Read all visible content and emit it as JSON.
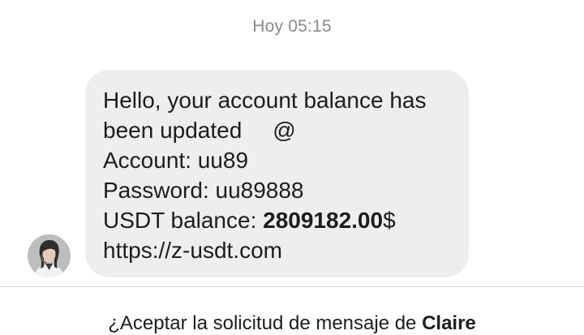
{
  "timestamp": "Hoy 05:15",
  "message": {
    "line1": "Hello, your account balance has",
    "line2": "been updated",
    "line2_symbol": "@",
    "account_label": "Account: ",
    "account_value": "uu89",
    "password_label": "Password: ",
    "password_value": "uu89888",
    "balance_label": "USDT balance: ",
    "balance_amount": "2809182.00",
    "balance_currency": "$",
    "link": "https://z-usdt.com"
  },
  "sender": {
    "avatar_icon": "person-avatar-icon"
  },
  "request": {
    "prefix": "¿Aceptar la solicitud de mensaje de ",
    "name": "Claire"
  },
  "colors": {
    "bubble": "#eeeeee",
    "timestamp": "#8a8a8a",
    "text": "#1d1d1d",
    "divider": "#d6d6d6"
  }
}
